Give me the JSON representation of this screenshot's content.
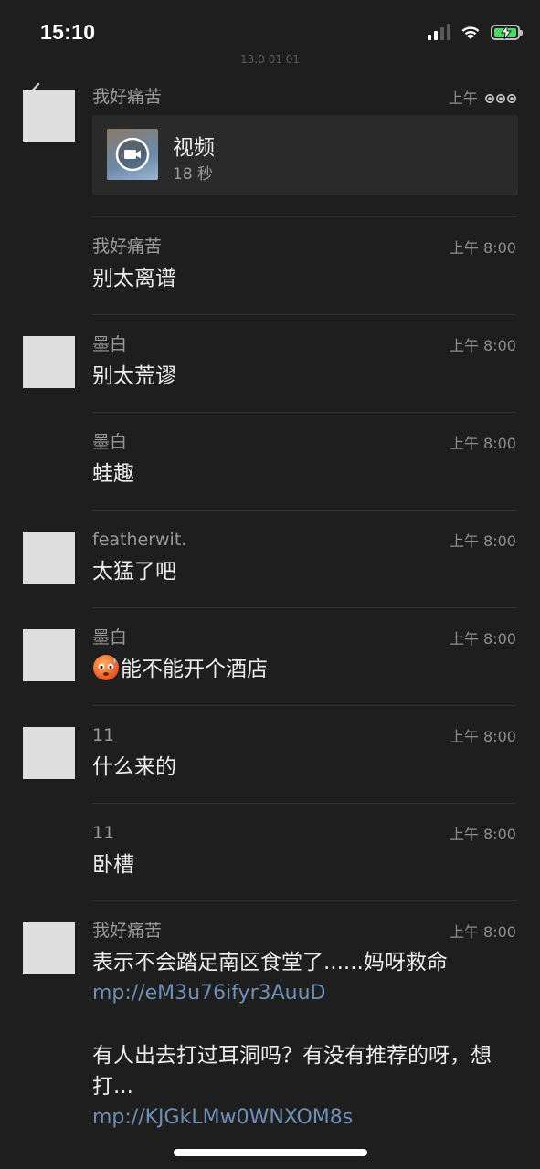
{
  "status_bar": {
    "time": "15:10"
  },
  "header": {
    "ghost_text": "13:0 01 01"
  },
  "messages": [
    {
      "sender": "我好痛苦",
      "time": "上午",
      "has_avatar": true,
      "video": {
        "title": "视频",
        "duration": "18 秒"
      }
    },
    {
      "sender": "我好痛苦",
      "time": "上午 8:00",
      "has_avatar": false,
      "text": "别太离谱"
    },
    {
      "sender": "墨白",
      "time": "上午 8:00",
      "has_avatar": true,
      "text": "别太荒谬"
    },
    {
      "sender": "墨白",
      "time": "上午 8:00",
      "has_avatar": false,
      "text": "蛙趣"
    },
    {
      "sender": "featherwit.",
      "time": "上午 8:00",
      "has_avatar": true,
      "text": "太猛了吧"
    },
    {
      "sender": "墨白",
      "time": "上午 8:00",
      "has_avatar": true,
      "text": "能不能开个酒店",
      "emoji": "cold-sweat-face"
    },
    {
      "sender": "11",
      "time": "上午 8:00",
      "has_avatar": true,
      "text": "什么来的"
    },
    {
      "sender": "11",
      "time": "上午 8:00",
      "has_avatar": false,
      "text": "卧槽"
    },
    {
      "sender": "我好痛苦",
      "time": "上午 8:00",
      "has_avatar": true,
      "text": "表示不会踏足南区食堂了......妈呀救命",
      "link1": "mp://eM3u76ifyr3AuuD",
      "text2": "有人出去打过耳洞吗？有没有推荐的呀，想打...",
      "link2": "mp://KJGkLMw0WNXOM8s"
    }
  ],
  "colors": {
    "background": "#1e1e1e",
    "link": "#6f8fb6",
    "battery": "#4cd964"
  }
}
